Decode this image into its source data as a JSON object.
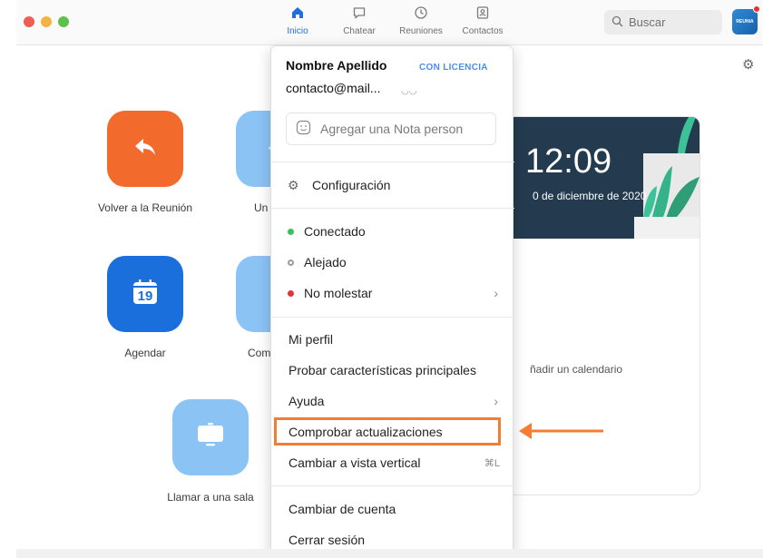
{
  "nav": {
    "tabs": [
      {
        "label": "Inicio",
        "icon": "home-icon",
        "active": true
      },
      {
        "label": "Chatear",
        "icon": "chat-icon",
        "active": false
      },
      {
        "label": "Reuniones",
        "icon": "clock-icon",
        "active": false
      },
      {
        "label": "Contactos",
        "icon": "contacts-icon",
        "active": false
      }
    ],
    "search_placeholder": "Buscar",
    "avatar_text": "REUNIA"
  },
  "home": {
    "tiles": [
      {
        "label": "Volver a la Reunión",
        "icon": "return-arrow-icon",
        "color": "#f36a2d"
      },
      {
        "label": "Un",
        "icon": "join-icon",
        "color": "#8cc3f5"
      },
      {
        "label": "Agendar",
        "icon": "calendar-icon",
        "calendar_day": "19",
        "color": "#1a6fdd"
      },
      {
        "label": "Com",
        "icon": "share-icon",
        "color": "#8cc3f5"
      },
      {
        "label": "Llamar a una sala",
        "icon": "room-icon",
        "color": "#8cc3f5"
      }
    ]
  },
  "card": {
    "time": "12:09",
    "date": "0 de diciembre de 2020",
    "calendar_text": "ñadir un calendario"
  },
  "menu": {
    "name": "Nombre Apellido",
    "license_badge": "CON LICENCIA",
    "email": "contacto@mail...",
    "note_placeholder": "Agregar una Nota person",
    "settings": "Configuración",
    "status": [
      {
        "label": "Conectado",
        "color": "#3cc05b"
      },
      {
        "label": "Alejado",
        "color": "#9a9a9a"
      },
      {
        "label": "No molestar",
        "color": "#e0343a"
      }
    ],
    "items": {
      "profile": "Mi perfil",
      "try_features": "Probar características principales",
      "help": "Ayuda",
      "check_updates": "Comprobar actualizaciones",
      "vertical_view": "Cambiar a vista vertical",
      "vertical_shortcut": "⌘L",
      "switch_account": "Cambiar de cuenta",
      "sign_out": "Cerrar sesión"
    }
  },
  "colors": {
    "accent": "#1e6fdc",
    "highlight": "#f47d34"
  }
}
